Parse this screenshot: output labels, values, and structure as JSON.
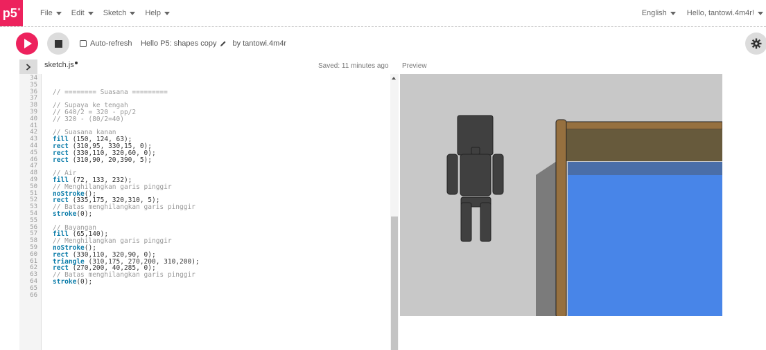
{
  "app": {
    "logo": "p5",
    "logo_sup": "*"
  },
  "menu": {
    "left": [
      {
        "label": "File"
      },
      {
        "label": "Edit"
      },
      {
        "label": "Sketch"
      },
      {
        "label": "Help"
      }
    ],
    "language": "English",
    "user": "Hello, tantowi.4m4r!"
  },
  "toolbar": {
    "autorefresh_label": "Auto-refresh",
    "project_name": "Hello P5: shapes copy",
    "by_user": "by tantowi.4m4r"
  },
  "editor": {
    "filename": "sketch.js",
    "saved_status": "Saved: 11 minutes ago",
    "preview_label": "Preview",
    "lines": [
      {
        "n": "34",
        "parts": []
      },
      {
        "n": "35",
        "parts": []
      },
      {
        "n": "36",
        "parts": [
          {
            "t": "// ======== Suasana =========",
            "c": "cm"
          }
        ]
      },
      {
        "n": "37",
        "parts": []
      },
      {
        "n": "38",
        "parts": [
          {
            "t": "// Supaya ke tengah",
            "c": "cm"
          }
        ]
      },
      {
        "n": "39",
        "parts": [
          {
            "t": "// 640/2 = 320 - pp/2",
            "c": "cm"
          }
        ]
      },
      {
        "n": "40",
        "parts": [
          {
            "t": "// 320 - (80/2=40)",
            "c": "cm"
          }
        ]
      },
      {
        "n": "41",
        "parts": []
      },
      {
        "n": "42",
        "parts": [
          {
            "t": "// Suasana kanan",
            "c": "cm"
          }
        ]
      },
      {
        "n": "43",
        "parts": [
          {
            "t": "fill",
            "c": "kw"
          },
          {
            "t": " (150, 124, 63);",
            "c": ""
          }
        ]
      },
      {
        "n": "44",
        "parts": [
          {
            "t": "rect",
            "c": "kw"
          },
          {
            "t": " (310,95, 330,15, 0);",
            "c": ""
          }
        ]
      },
      {
        "n": "45",
        "parts": [
          {
            "t": "rect",
            "c": "kw"
          },
          {
            "t": " (330,110, 320,60, 0);",
            "c": ""
          }
        ]
      },
      {
        "n": "46",
        "parts": [
          {
            "t": "rect",
            "c": "kw"
          },
          {
            "t": " (310,90, 20,390, 5);",
            "c": ""
          }
        ]
      },
      {
        "n": "47",
        "parts": []
      },
      {
        "n": "48",
        "parts": [
          {
            "t": "// Air",
            "c": "cm"
          }
        ]
      },
      {
        "n": "49",
        "parts": [
          {
            "t": "fill",
            "c": "kw"
          },
          {
            "t": " (72, 133, 232);",
            "c": ""
          }
        ]
      },
      {
        "n": "50",
        "parts": [
          {
            "t": "// Menghilangkan garis pinggir",
            "c": "cm"
          }
        ]
      },
      {
        "n": "51",
        "parts": [
          {
            "t": "noStroke",
            "c": "kw"
          },
          {
            "t": "();",
            "c": ""
          }
        ]
      },
      {
        "n": "52",
        "parts": [
          {
            "t": "rect",
            "c": "kw"
          },
          {
            "t": " (335,175, 320,310, 5);",
            "c": ""
          }
        ]
      },
      {
        "n": "53",
        "parts": [
          {
            "t": "// Batas menghilangkan garis pinggir",
            "c": "cm"
          }
        ]
      },
      {
        "n": "54",
        "parts": [
          {
            "t": "stroke",
            "c": "kw"
          },
          {
            "t": "(0);",
            "c": ""
          }
        ]
      },
      {
        "n": "55",
        "parts": []
      },
      {
        "n": "56",
        "parts": [
          {
            "t": "// Bayangan",
            "c": "cm"
          }
        ]
      },
      {
        "n": "57",
        "parts": [
          {
            "t": "fill",
            "c": "kw"
          },
          {
            "t": " (65,140);",
            "c": ""
          }
        ]
      },
      {
        "n": "58",
        "parts": [
          {
            "t": "// Menghilangkan garis pinggir",
            "c": "cm"
          }
        ]
      },
      {
        "n": "59",
        "parts": [
          {
            "t": "noStroke",
            "c": "kw"
          },
          {
            "t": "();",
            "c": ""
          }
        ]
      },
      {
        "n": "60",
        "parts": [
          {
            "t": "rect",
            "c": "kw"
          },
          {
            "t": " (330,110, 320,90, 0);",
            "c": ""
          }
        ]
      },
      {
        "n": "61",
        "parts": [
          {
            "t": "triangle",
            "c": "kw"
          },
          {
            "t": " (310,175, 270,200, 310,200);",
            "c": ""
          }
        ]
      },
      {
        "n": "62",
        "parts": [
          {
            "t": "rect",
            "c": "kw"
          },
          {
            "t": " (270,200, 40,285, 0);",
            "c": ""
          }
        ]
      },
      {
        "n": "63",
        "parts": [
          {
            "t": "// Batas menghilangkan garis pinggir",
            "c": "cm"
          }
        ]
      },
      {
        "n": "64",
        "parts": [
          {
            "t": "stroke",
            "c": "kw"
          },
          {
            "t": "(0);",
            "c": ""
          }
        ]
      },
      {
        "n": "65",
        "parts": []
      },
      {
        "n": "66",
        "parts": []
      }
    ]
  },
  "colors": {
    "accent": "#ed225d",
    "keyword": "#0b7ca9",
    "comment": "#999999",
    "canvas_bg": "#c8c8c8",
    "wood": "#96703f",
    "wood_dark": "#675a3c",
    "water": "#4885e8",
    "shadow": "#7b7b7b",
    "figure": "#404040"
  }
}
